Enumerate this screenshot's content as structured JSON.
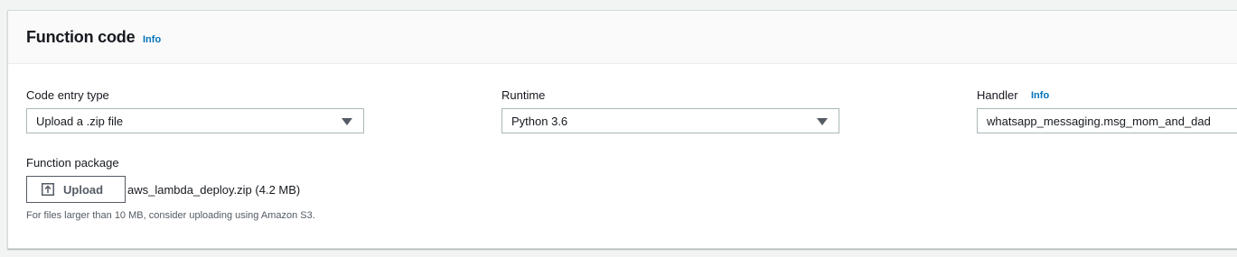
{
  "section": {
    "title": "Function code",
    "info_label": "Info"
  },
  "code_entry": {
    "label": "Code entry type",
    "value": "Upload a .zip file"
  },
  "runtime": {
    "label": "Runtime",
    "value": "Python 3.6"
  },
  "handler": {
    "label": "Handler",
    "info_label": "Info",
    "value": "whatsapp_messaging.msg_mom_and_dad"
  },
  "package": {
    "label": "Function package",
    "upload_label": "Upload",
    "filename": "aws_lambda_deploy.zip (4.2 MB)",
    "hint": "For files larger than 10 MB, consider uploading using Amazon S3."
  }
}
